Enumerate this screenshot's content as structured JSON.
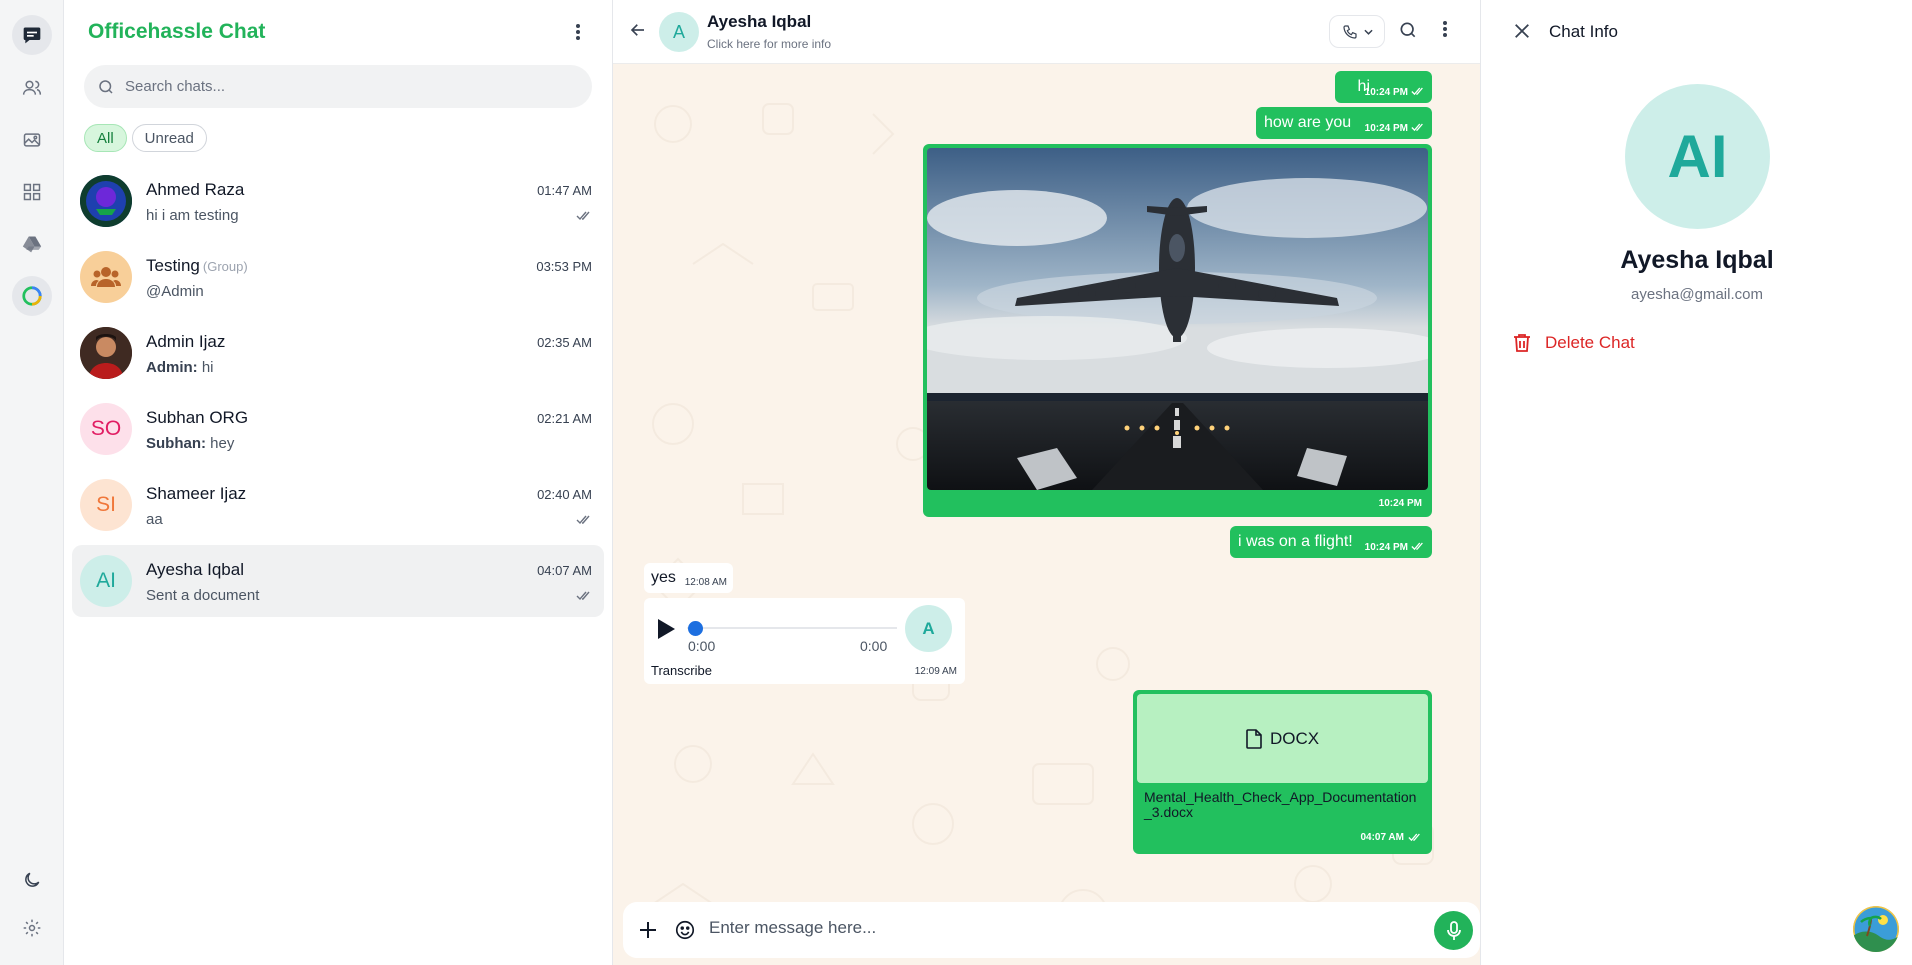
{
  "app": {
    "title": "Officehassle Chat"
  },
  "rail": {
    "icons": [
      "chats-icon",
      "users-icon",
      "gallery-icon",
      "apps-icon",
      "drive-icon",
      "status-icon",
      "dark-mode-icon",
      "settings-icon"
    ]
  },
  "search": {
    "placeholder": "Search chats..."
  },
  "filters": [
    {
      "label": "All",
      "active": true
    },
    {
      "label": "Unread",
      "active": false
    }
  ],
  "chats": [
    {
      "name": "Ahmed Raza",
      "tag": "",
      "time": "01:47 AM",
      "sender": "",
      "preview": "hi i am testing",
      "read": true
    },
    {
      "name": "Testing",
      "tag": "(Group)",
      "time": "03:53 PM",
      "sender": "",
      "preview": "@Admin",
      "read": false
    },
    {
      "name": "Admin Ijaz",
      "tag": "",
      "time": "02:35 AM",
      "sender": "Admin:",
      "preview": "hi",
      "read": false
    },
    {
      "name": "Subhan ORG",
      "tag": "",
      "initials": "SO",
      "time": "02:21 AM",
      "sender": "Subhan:",
      "preview": "hey",
      "read": false
    },
    {
      "name": "Shameer Ijaz",
      "tag": "",
      "initials": "SI",
      "time": "02:40 AM",
      "sender": "",
      "preview": "aa",
      "read": true
    },
    {
      "name": "Ayesha Iqbal",
      "tag": "",
      "initials": "AI",
      "time": "04:07 AM",
      "sender": "",
      "preview": "Sent a document",
      "read": true
    }
  ],
  "conversation": {
    "name": "Ayesha Iqbal",
    "initial": "A",
    "subtitle": "Click here for more info",
    "messages": {
      "m1": {
        "text": "hi",
        "time": "10:24 PM"
      },
      "m2": {
        "text": "how are you",
        "time": "10:24 PM"
      },
      "m3": {
        "time": "10:24 PM"
      },
      "m4": {
        "text": "i was on a flight!",
        "time": "10:24 PM"
      },
      "m5": {
        "text": "yes",
        "time": "12:08 AM"
      },
      "m6": {
        "elapsed": "0:00",
        "duration": "0:00",
        "initial": "A",
        "transcribe": "Transcribe",
        "time": "12:09 AM"
      },
      "m7": {
        "type_label": "DOCX",
        "filename": "Mental_Health_Check_App_Documentation_3.docx",
        "time": "04:07 AM"
      }
    },
    "composer_placeholder": "Enter message here..."
  },
  "info": {
    "title": "Chat Info",
    "initials": "AI",
    "name": "Ayesha Iqbal",
    "email": "ayesha@gmail.com",
    "delete_label": "Delete Chat"
  },
  "colors": {
    "brand": "#22b35a",
    "bubble_out": "#22c05e",
    "danger": "#dc2626",
    "teal": "#1fa99b"
  }
}
